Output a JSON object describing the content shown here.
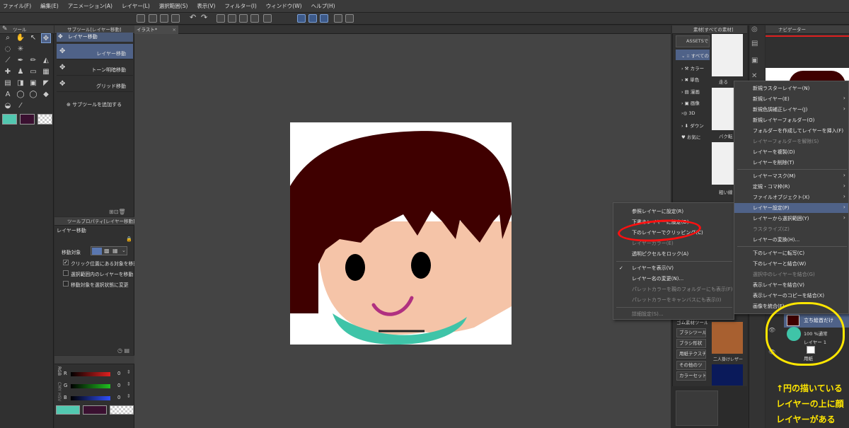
{
  "menubar": [
    "ファイル(F)",
    "編集(E)",
    "アニメーション(A)",
    "レイヤー(L)",
    "選択範囲(S)",
    "表示(V)",
    "フィルター(I)",
    "ウィンドウ(W)",
    "ヘルプ(H)"
  ],
  "panels": {
    "tool_title": "ツール",
    "subtool_title": "サブツール[レイヤー移動]",
    "canvas_tab": "イラスト*",
    "material_title": "素材[すべての素材]",
    "navigator_title": "ナビゲーター",
    "toolprop_title": "ツールプロパティ[レイヤー移動]",
    "toolprop_header": "レイヤー移動",
    "color_title": ""
  },
  "subtool": {
    "group_label": "レイヤー移動",
    "items": [
      "レイヤー移動",
      "トーン明暗移動",
      "グリッド移動"
    ],
    "add_label": "サブツールを追加する"
  },
  "toolprop": {
    "target_label": "移動対象",
    "options": [
      {
        "label": "クリック位置にある対象を移動",
        "checked": true
      },
      {
        "label": "選択範囲内のレイヤーを移動",
        "checked": false
      },
      {
        "label": "移動対象を選択状態に変更",
        "checked": false
      }
    ]
  },
  "color_rgb": {
    "side_label": "RGB",
    "side_label2": "CMY HSV",
    "channels": [
      {
        "name": "R",
        "value": "0",
        "color": "#e02020"
      },
      {
        "name": "G",
        "value": "0",
        "color": "#20c020"
      },
      {
        "name": "B",
        "value": "0",
        "color": "#3050ff"
      }
    ],
    "main_color": "#52c8b0",
    "sub_color": "#3a1030"
  },
  "material": {
    "assets_label": "ASSETSで",
    "tree": [
      {
        "label": "すべての"
      },
      {
        "label": "カラー"
      },
      {
        "label": "単色"
      },
      {
        "label": "漫画"
      },
      {
        "label": "画像"
      },
      {
        "label": "3D"
      },
      {
        "label": "ダウン"
      },
      {
        "label": "お気に"
      }
    ],
    "thumbs": [
      "走る",
      "バク転",
      "粗い線"
    ],
    "lower_thumbs": [
      "二人掛けレザー"
    ],
    "brushes": [
      "ブラシツール",
      "ブラシ形状",
      "用紙テクスチ",
      "その他のツ",
      "カラーセット"
    ],
    "brush_top": "ゴム素材ツール"
  },
  "context_left": {
    "items": [
      {
        "label": "参照レイヤーに設定(R)",
        "disabled": false
      },
      {
        "label": "下書きレイヤーに設定(D)",
        "disabled": false
      },
      {
        "label": "下のレイヤーでクリッピング(C)",
        "disabled": false
      },
      {
        "label": "レイヤーカラー(E)",
        "disabled": false
      },
      {
        "label": "透明ピクセルをロック(A)",
        "disabled": false
      },
      {
        "label": "レイヤーを表示(V)",
        "disabled": false,
        "check": "✓"
      },
      {
        "label": "レイヤー名の変更(N)...",
        "disabled": false
      },
      {
        "label": "パレットカラーを親のフォルダーにも表示(F)",
        "disabled": true
      },
      {
        "label": "パレットカラーをキャンバスにも表示(I)",
        "disabled": true
      },
      {
        "label": "詳細設定(S)...",
        "disabled": true
      }
    ]
  },
  "context_right": {
    "items": [
      {
        "label": "新規ラスターレイヤー(N)",
        "disabled": false,
        "sub": false
      },
      {
        "label": "新規レイヤー(E)",
        "disabled": false,
        "sub": true
      },
      {
        "label": "新規色調補正レイヤー(J)",
        "disabled": false,
        "sub": true
      },
      {
        "label": "新規レイヤーフォルダー(O)",
        "disabled": false,
        "sub": false
      },
      {
        "label": "フォルダーを作成してレイヤーを挿入(F)",
        "disabled": false,
        "sub": false
      },
      {
        "label": "レイヤーフォルダーを解除(S)",
        "disabled": true,
        "sub": false
      },
      {
        "label": "レイヤーを複製(D)",
        "disabled": false,
        "sub": false
      },
      {
        "label": "レイヤーを削除(T)",
        "disabled": false,
        "sub": false
      },
      {
        "label": "レイヤーマスク(M)",
        "disabled": false,
        "sub": true
      },
      {
        "label": "定規・コマ枠(R)",
        "disabled": false,
        "sub": true
      },
      {
        "label": "ファイルオブジェクト(X)",
        "disabled": false,
        "sub": true
      },
      {
        "label": "レイヤー設定(P)",
        "disabled": false,
        "sub": true,
        "selected": true
      },
      {
        "label": "レイヤーから選択範囲(Y)",
        "disabled": false,
        "sub": true
      },
      {
        "label": "ラスタライズ(Z)",
        "disabled": true,
        "sub": false
      },
      {
        "label": "レイヤーの変換(H)...",
        "disabled": false,
        "sub": false
      },
      {
        "label": "下のレイヤーに転写(C)",
        "disabled": false,
        "sub": false
      },
      {
        "label": "下のレイヤーと結合(W)",
        "disabled": false,
        "sub": false
      },
      {
        "label": "選択中のレイヤーを結合(G)",
        "disabled": true,
        "sub": false
      },
      {
        "label": "表示レイヤーを結合(V)",
        "disabled": false,
        "sub": false
      },
      {
        "label": "表示レイヤーのコピーを結合(X)",
        "disabled": false,
        "sub": false
      },
      {
        "label": "画像を統合(F)",
        "disabled": false,
        "sub": false
      }
    ]
  },
  "layers": [
    {
      "name": "立ち絵首だけ",
      "selected": true
    },
    {
      "name": "100 %通常",
      "selected": false
    },
    {
      "name": "レイヤー 1",
      "selected": false
    },
    {
      "name": "用紙",
      "selected": false
    }
  ],
  "annotation": [
    "↑円の描いている",
    "レイヤーの上に顔",
    "レイヤーがある"
  ],
  "colors": {
    "accent": "#4f6288",
    "highlight_red": "#ff0000",
    "highlight_yellow": "#ffe600"
  }
}
